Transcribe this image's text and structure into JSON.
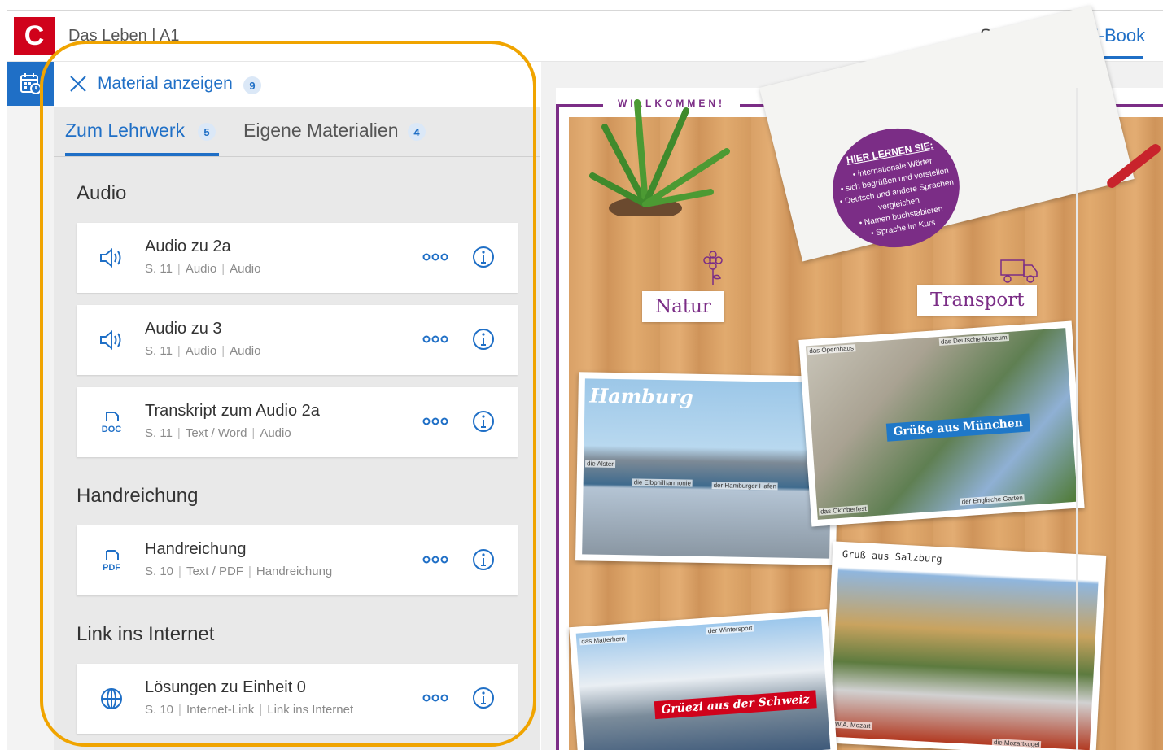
{
  "header": {
    "logo_letter": "C",
    "title": "Das Leben | A1",
    "nav": {
      "start": "Startseite",
      "ebook": "E-Book"
    }
  },
  "panel": {
    "title": "Material anzeigen",
    "count": "9",
    "tabs": [
      {
        "label": "Zum Lehrwerk",
        "count": "5"
      },
      {
        "label": "Eigene Materialien",
        "count": "4"
      }
    ],
    "sections": [
      {
        "title": "Audio",
        "items": [
          {
            "icon": "speaker-icon",
            "title": "Audio zu 2a",
            "page": "S. 11",
            "type": "Audio",
            "category": "Audio"
          },
          {
            "icon": "speaker-icon",
            "title": "Audio zu 3",
            "page": "S. 11",
            "type": "Audio",
            "category": "Audio"
          },
          {
            "icon": "doc-file-icon",
            "icon_text": "DOC",
            "title": "Transkript zum Audio 2a",
            "page": "S. 11",
            "type": "Text / Word",
            "category": "Audio"
          }
        ]
      },
      {
        "title": "Handreichung",
        "items": [
          {
            "icon": "pdf-file-icon",
            "icon_text": "PDF",
            "title": "Handreichung",
            "page": "S. 10",
            "type": "Text / PDF",
            "category": "Handreichung"
          }
        ]
      },
      {
        "title": "Link ins Internet",
        "items": [
          {
            "icon": "globe-icon",
            "title": "Lösungen zu Einheit 0",
            "page": "S. 10",
            "type": "Internet-Link",
            "category": "Link ins Internet"
          }
        ]
      }
    ]
  },
  "book": {
    "banner": "WILLKOMMEN!",
    "learn_box": {
      "title": "HIER LERNEN SIE:",
      "points": [
        "• internationale Wörter",
        "• sich begrüßen und vorstellen",
        "• Deutsch und andere Sprachen vergleichen",
        "• Namen buchstabieren",
        "• Sprache im Kurs"
      ]
    },
    "labels": {
      "natur": "Natur",
      "transport": "Transport"
    },
    "postcards": {
      "hamburg": {
        "caption": "Hamburg",
        "tags": [
          "die Alster",
          "die Elbphilharmonie",
          "der Hamburger Hafen"
        ]
      },
      "muenchen": {
        "caption": "Grüße aus München",
        "tags": [
          "das Opernhaus",
          "das Deutsche Museum",
          "das Oktoberfest",
          "der Englische Garten"
        ]
      },
      "salzburg": {
        "caption": "Gruß aus Salzburg",
        "tags": [
          "W.A. Mozart",
          "die Mozartkugel"
        ]
      },
      "schweiz": {
        "caption": "Grüezi aus der Schweiz",
        "tags": [
          "das Matterhorn",
          "der Wintersport"
        ]
      }
    },
    "colors": {
      "accent_purple": "#7b2d86",
      "brand_red": "#d0021b",
      "link_blue": "#1f6fc6",
      "highlight_orange": "#f0a400"
    }
  }
}
